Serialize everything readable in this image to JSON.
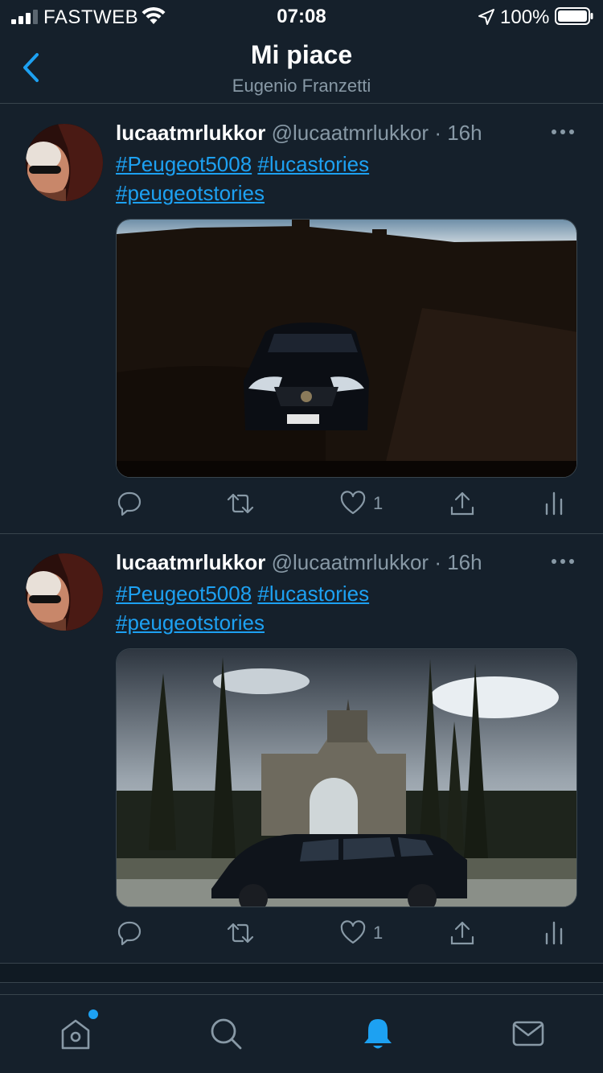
{
  "status_bar": {
    "carrier": "FASTWEB",
    "time": "07:08",
    "battery": "100%"
  },
  "header": {
    "title": "Mi piace",
    "subtitle": "Eugenio Franzetti"
  },
  "tweets": [
    {
      "name": "lucaatmrlukkor",
      "handle": "@lucaatmrlukkor",
      "time": "· 16h",
      "hashtags": [
        "#Peugeot5008",
        "#lucastories",
        "#peugeotstories"
      ],
      "likes": "1"
    },
    {
      "name": "lucaatmrlukkor",
      "handle": "@lucaatmrlukkor",
      "time": "· 16h",
      "hashtags": [
        "#Peugeot5008",
        "#lucastories",
        "#peugeotstories"
      ],
      "likes": "1"
    }
  ],
  "colors": {
    "background": "#15202b",
    "accent": "#1da1f2",
    "muted": "#8899a6",
    "border": "#38444d"
  },
  "icons": {
    "back": "chevron-left-icon",
    "reply": "reply-icon",
    "retweet": "retweet-icon",
    "like": "heart-icon",
    "share": "share-icon",
    "analytics": "analytics-icon",
    "more": "more-icon",
    "home": "home-icon",
    "search": "search-icon",
    "notifications": "bell-icon",
    "messages": "mail-icon"
  }
}
